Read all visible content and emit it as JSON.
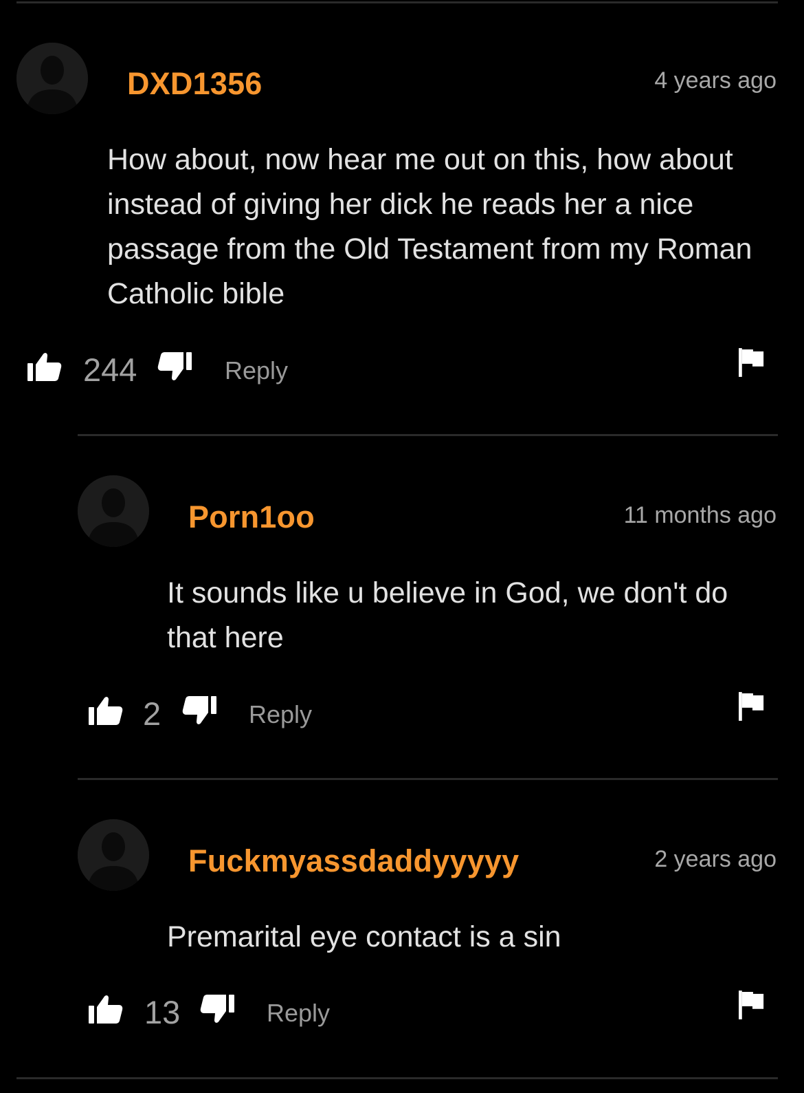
{
  "comments": [
    {
      "username": "DXD1356",
      "timestamp": "4 years ago",
      "text": "How about, now hear me out on this, how about instead of giving her dick he reads her a nice passage from the Old Testament from my Roman Catholic bible",
      "likes": "244",
      "reply_label": "Reply"
    },
    {
      "username": "Porn1oo",
      "timestamp": "11 months ago",
      "text": "It sounds like u believe in God, we don't do that here",
      "likes": "2",
      "reply_label": "Reply"
    },
    {
      "username": "Fuckmyassdaddyyyyy",
      "timestamp": "2 years ago",
      "text": "Premarital eye contact is a sin",
      "likes": "13",
      "reply_label": "Reply"
    }
  ],
  "icons": {
    "like": "thumbs-up-icon",
    "dislike": "thumbs-down-icon",
    "report": "flag-icon",
    "avatar": "default-avatar-silhouette"
  },
  "colors": {
    "background": "#000000",
    "username": "#f7962f",
    "text": "#e2e2e2",
    "muted": "#a2a2a2",
    "divider": "#2a2a2a"
  }
}
